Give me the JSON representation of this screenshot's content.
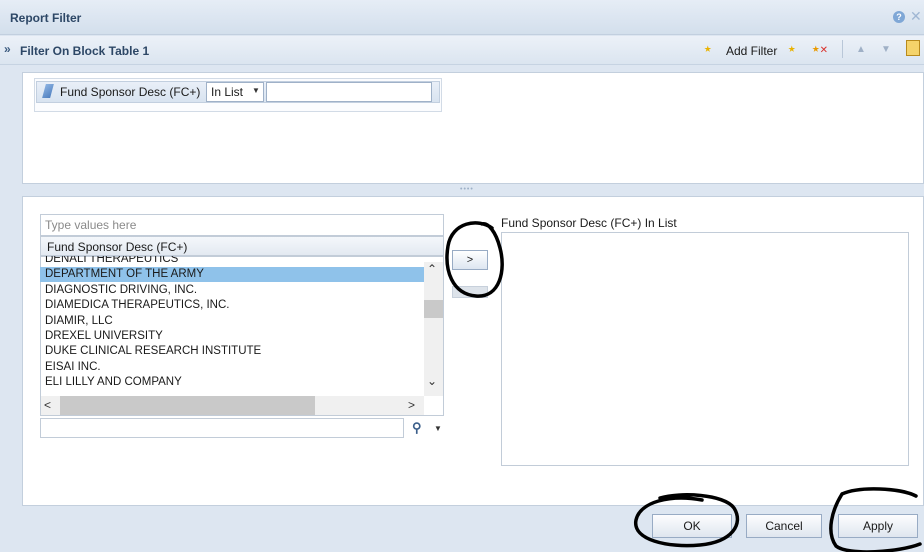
{
  "window": {
    "title": "Report Filter"
  },
  "toolbar": {
    "title": "Filter On Block Table 1",
    "add_filter_label": "Add Filter"
  },
  "condition": {
    "object_label": "Fund Sponsor Desc (FC+)",
    "operator": "In List",
    "value": ""
  },
  "values": {
    "placeholder": "Type values here",
    "list_header": "Fund Sponsor Desc (FC+)",
    "items": [
      "DENALI THERAPEUTICS",
      "DEPARTMENT OF THE ARMY",
      "DIAGNOSTIC DRIVING, INC.",
      "DIAMEDICA THERAPEUTICS, INC.",
      "DIAMIR, LLC",
      "DREXEL UNIVERSITY",
      "DUKE CLINICAL RESEARCH INSTITUTE",
      "EISAI INC.",
      "ELI LILLY AND COMPANY"
    ],
    "selected_index": 1,
    "move_label": ">",
    "search_value": ""
  },
  "selected_panel": {
    "label": "Fund Sponsor Desc (FC+) In List"
  },
  "buttons": {
    "ok": "OK",
    "cancel": "Cancel",
    "apply": "Apply"
  },
  "icons": [
    "help-icon",
    "close-icon",
    "add-filter-icon",
    "filter-icon",
    "remove-filter-icon",
    "move-up-icon",
    "move-down-icon",
    "grid-icon",
    "binoculars-icon"
  ]
}
